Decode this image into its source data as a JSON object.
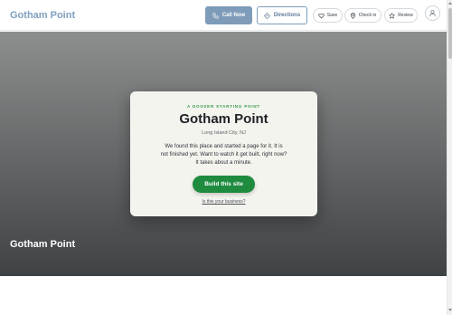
{
  "header": {
    "brand": "Gotham Point",
    "call_label": "Call Now",
    "directions_label": "Directions",
    "save_label": "Save",
    "checkin_label": "Check in",
    "review_label": "Review"
  },
  "hero": {
    "business_name": "Gotham Point"
  },
  "card": {
    "eyebrow": "A DOOZER STARTING POINT",
    "title": "Gotham Point",
    "location": "Long Island City, NJ",
    "message_line1": "We found this place and started a page for it. It is",
    "message_line2": "not finished yet. Want to watch it get built, right now?",
    "message_line3": "It takes about a minute.",
    "build_label": "Build this site",
    "business_link": "Is this your business?"
  },
  "colors": {
    "brand": "#7f9fbe",
    "accent_green": "#1f8b3e",
    "eyebrow_green": "#2e9a44",
    "call_button": "#7e9cb9"
  },
  "icons": {
    "call": "phone-icon",
    "directions": "directions-icon",
    "save": "heart-icon",
    "checkin": "map-pin-icon",
    "review": "star-icon",
    "avatar": "user-icon"
  }
}
